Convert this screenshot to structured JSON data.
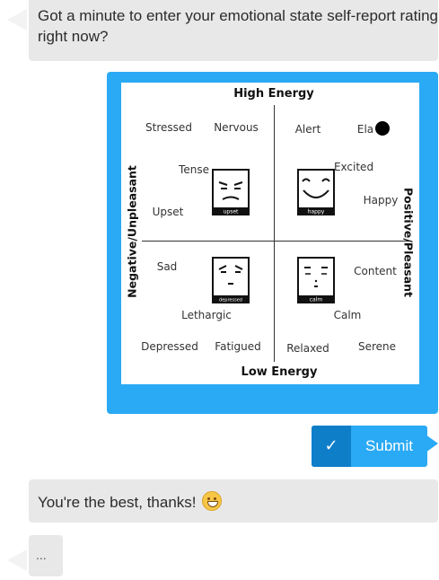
{
  "messages": {
    "question": "Got a minute to enter your emotional state self-report rating right now?",
    "thanks": "You're the best, thanks!",
    "typing": "..."
  },
  "grid": {
    "top_label": "High Energy",
    "bottom_label": "Low Energy",
    "left_label": "Negative/Unpleasant",
    "right_label": "Positive/Pleasant",
    "words": {
      "stressed": "Stressed",
      "nervous": "Nervous",
      "alert": "Alert",
      "elated": "Ela",
      "tense": "Tense",
      "excited": "Excited",
      "upset": "Upset",
      "happy": "Happy",
      "sad": "Sad",
      "content": "Content",
      "lethargic": "Lethargic",
      "calm": "Calm",
      "depressed": "Depressed",
      "fatigued": "Fatigued",
      "relaxed": "Relaxed",
      "serene": "Serene"
    },
    "faces": {
      "upset": "upset",
      "happy": "happy",
      "depressed": "depressed",
      "calm": "calm"
    }
  },
  "submit": {
    "check_icon": "check-icon",
    "label": "Submit"
  },
  "colors": {
    "accent": "#2aa9f4",
    "accent_dark": "#0f7ec9",
    "bubble": "#e8e8e8"
  }
}
